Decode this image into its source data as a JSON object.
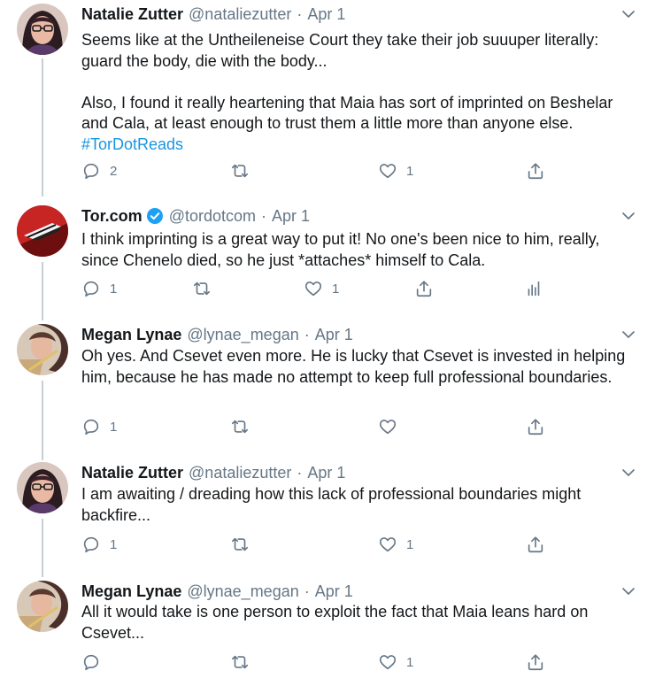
{
  "tweets": [
    {
      "author": "Natalie Zutter",
      "handle": "@nataliezutter",
      "separator": "·",
      "date": "Apr 1",
      "paragraph1": "Seems like at the Untheileneise Court they take their job suuuper literally: guard the body, die with the body...",
      "paragraph2": "Also, I found it really heartening that Maia has sort of imprinted on Beshelar and Cala, at least enough to trust them a little more than anyone else.",
      "hashtag": "#TorDotReads",
      "replies": "2",
      "retweets": "",
      "likes": "1"
    },
    {
      "author": "Tor.com",
      "verified": true,
      "handle": "@tordotcom",
      "separator": "·",
      "date": "Apr 1",
      "text": "I think imprinting is a great way to put it! No one's been nice to him, really, since Chenelo died, so he just *attaches* himself to Cala.",
      "replies": "1",
      "retweets": "",
      "likes": "1"
    },
    {
      "author": "Megan Lynae",
      "handle": "@lynae_megan",
      "separator": "·",
      "date": "Apr 1",
      "text": "Oh yes. And Csevet even more. He is lucky that Csevet is invested in helping him, because he has made no attempt to keep full professional boundaries.",
      "replies": "1",
      "retweets": "",
      "likes": ""
    },
    {
      "author": "Natalie Zutter",
      "handle": "@nataliezutter",
      "separator": "·",
      "date": "Apr 1",
      "text": "I am awaiting / dreading how this lack of professional boundaries might backfire...",
      "replies": "1",
      "retweets": "",
      "likes": "1"
    },
    {
      "author": "Megan Lynae",
      "handle": "@lynae_megan",
      "separator": "·",
      "date": "Apr 1",
      "text": "All it would take is one person to exploit the fact that Maia leans hard on Csevet...",
      "replies": "",
      "retweets": "",
      "likes": "1"
    }
  ],
  "icons": {
    "reply": "reply-icon",
    "retweet": "retweet-icon",
    "like": "like-icon",
    "share": "share-icon",
    "analytics": "analytics-icon",
    "caret": "chevron-down-icon",
    "verified": "verified-badge-icon"
  },
  "colors": {
    "text": "#14171a",
    "muted": "#657786",
    "link": "#1b95e0",
    "thread_line": "#c4cfd6",
    "verified": "#1da1f2"
  }
}
